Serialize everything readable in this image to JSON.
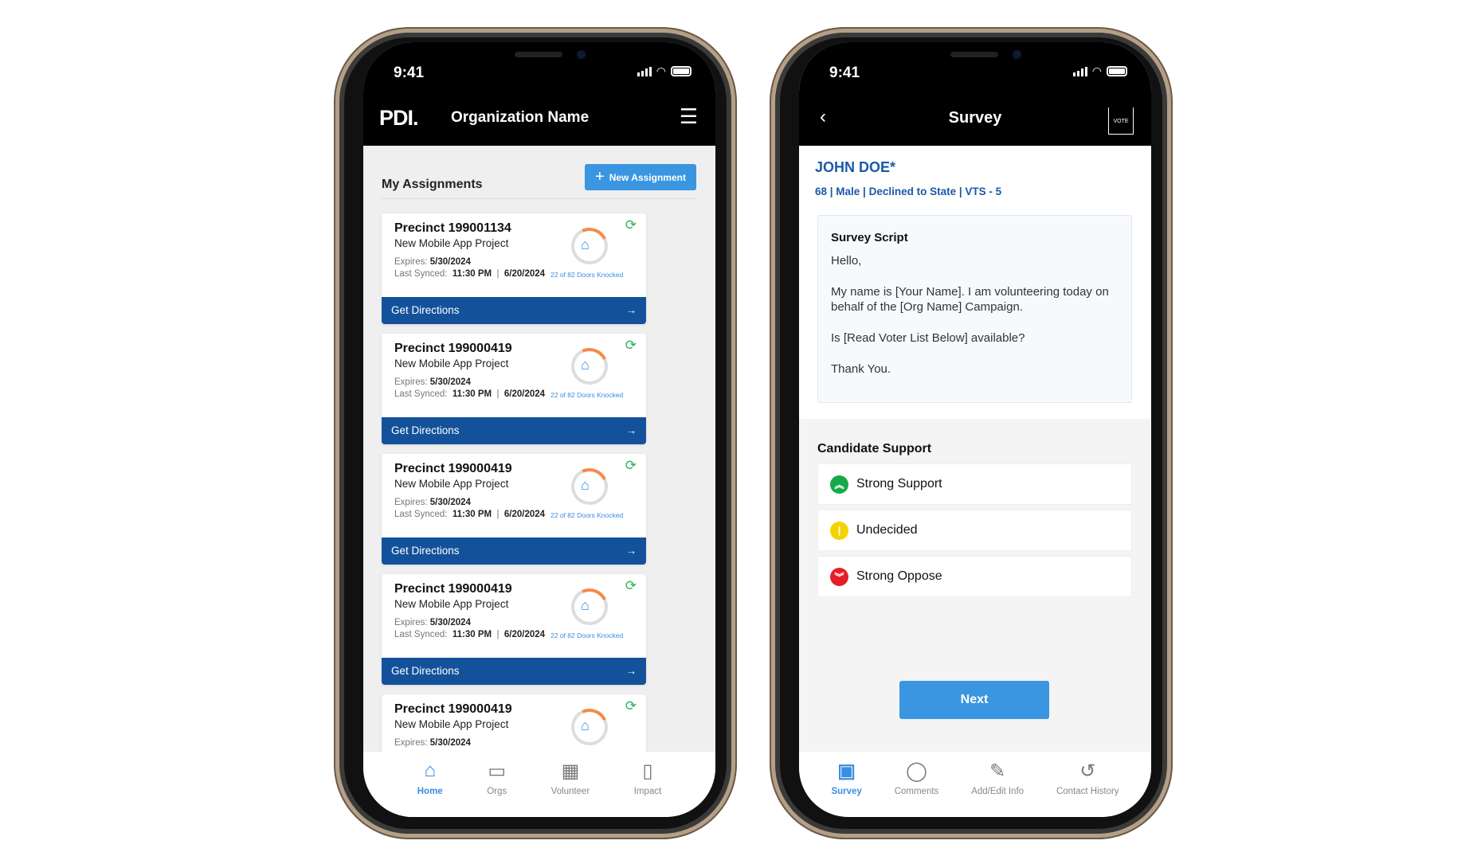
{
  "status": {
    "time": "9:41"
  },
  "home": {
    "logo": "PDI.",
    "title": "Organization Name",
    "section_title": "My Assignments",
    "new_assignment": "New Assignment",
    "cards": [
      {
        "precinct": "Precinct 199001134",
        "project": "New Mobile App Project",
        "expires_label": "Expires:",
        "expires": "5/30/2024",
        "synced_label": "Last Synced:",
        "synced_time": "11:30 PM",
        "synced_date": "6/20/2024",
        "doors": "22 of 82 Doors Knocked",
        "directions": "Get Directions"
      },
      {
        "precinct": "Precinct 199000419",
        "project": "New Mobile App Project",
        "expires_label": "Expires:",
        "expires": "5/30/2024",
        "synced_label": "Last Synced:",
        "synced_time": "11:30 PM",
        "synced_date": "6/20/2024",
        "doors": "22 of 82 Doors Knocked",
        "directions": "Get Directions"
      },
      {
        "precinct": "Precinct 199000419",
        "project": "New Mobile App Project",
        "expires_label": "Expires:",
        "expires": "5/30/2024",
        "synced_label": "Last Synced:",
        "synced_time": "11:30 PM",
        "synced_date": "6/20/2024",
        "doors": "22 of 82 Doors Knocked",
        "directions": "Get Directions"
      },
      {
        "precinct": "Precinct 199000419",
        "project": "New Mobile App Project",
        "expires_label": "Expires:",
        "expires": "5/30/2024",
        "synced_label": "Last Synced:",
        "synced_time": "11:30 PM",
        "synced_date": "6/20/2024",
        "doors": "22 of 82 Doors Knocked",
        "directions": "Get Directions"
      },
      {
        "precinct": "Precinct 199000419",
        "project": "New Mobile App Project",
        "expires_label": "Expires:",
        "expires": "5/30/2024",
        "synced_label": "",
        "synced_time": "",
        "synced_date": "",
        "doors": "",
        "directions": ""
      }
    ],
    "nav": [
      {
        "label": "Home",
        "icon": "home-icon",
        "active": true
      },
      {
        "label": "Orgs",
        "icon": "orgs-icon"
      },
      {
        "label": "Volunteer",
        "icon": "calendar-icon"
      },
      {
        "label": "Impact",
        "icon": "report-icon"
      }
    ]
  },
  "survey": {
    "title": "Survey",
    "vote_label": "VOTE",
    "voter_name": "JOHN DOE*",
    "voter_meta": "68 | Male | Declined to State | VTS - 5",
    "script_title": "Survey Script",
    "script_lines": [
      "Hello,",
      "My name is [Your Name]. I am volunteering today on behalf of the [Org Name] Campaign.",
      "Is [Read Voter List Below] available?",
      "Thank You."
    ],
    "support_title": "Candidate Support",
    "options": [
      {
        "label": "Strong Support",
        "color": "#17a84b"
      },
      {
        "label": "Undecided",
        "color": "#f5d300"
      },
      {
        "label": "Strong Oppose",
        "color": "#e61e2a"
      }
    ],
    "next": "Next",
    "nav": [
      {
        "label": "Survey",
        "active": true
      },
      {
        "label": "Comments"
      },
      {
        "label": "Add/Edit Info"
      },
      {
        "label": "Contact History"
      }
    ]
  },
  "colors": {
    "accent": "#3a96e0",
    "directions": "#13529b"
  }
}
